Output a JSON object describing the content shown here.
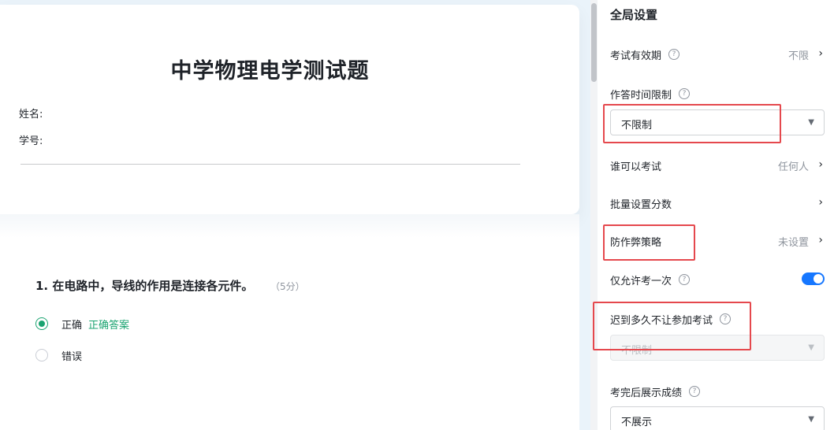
{
  "exam": {
    "title": "中学物理电学测试题",
    "name_label": "姓名:",
    "id_label": "学号:"
  },
  "question": {
    "title": "1. 在电路中，导线的作用是连接各元件。",
    "score": "（5分）",
    "options": [
      {
        "text": "正确",
        "checked": true,
        "correct_tag": "正确答案"
      },
      {
        "text": "错误",
        "checked": false,
        "correct_tag": ""
      }
    ]
  },
  "panel": {
    "title": "全局设置",
    "help_glyph": "?",
    "chevron": "›",
    "select_arrow": "▼",
    "validity": {
      "label": "考试有效期",
      "value": "不限"
    },
    "time_limit": {
      "label": "作答时间限制",
      "selected": "不限制"
    },
    "who_can": {
      "label": "谁可以考试",
      "value": "任何人"
    },
    "batch_score": {
      "label": "批量设置分数"
    },
    "anti_cheat": {
      "label": "防作弊策略",
      "value": "未设置"
    },
    "once_only": {
      "label": "仅允许考一次",
      "enabled": true
    },
    "late_limit": {
      "label": "迟到多久不让参加考试",
      "selected": "不限制",
      "disabled": true
    },
    "show_score": {
      "label": "考完后展示成绩",
      "selected": "不展示"
    }
  },
  "colors": {
    "accent_green": "#1aa370",
    "toggle_blue": "#1677ff",
    "highlight_red": "#e5484d"
  }
}
